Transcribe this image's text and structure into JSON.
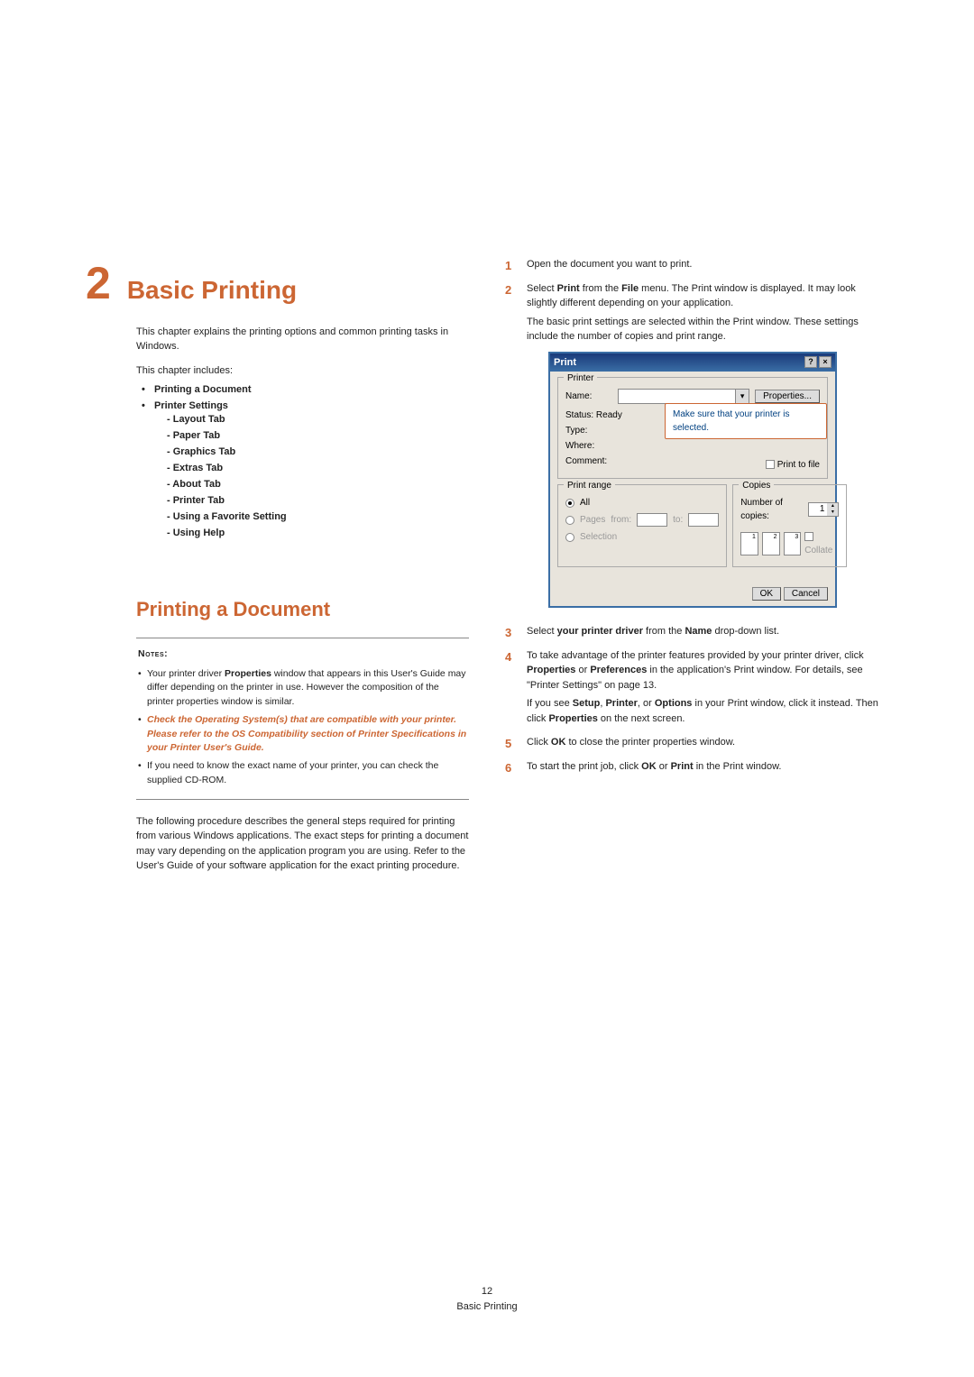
{
  "chapter": {
    "number": "2",
    "title": "Basic Printing",
    "intro": "This chapter explains the printing options and common printing tasks in Windows.",
    "includes_label": "This chapter includes:",
    "toc": [
      "Printing a Document",
      "Printer Settings"
    ],
    "toc_sub": [
      "- Layout Tab",
      "- Paper Tab",
      "- Graphics Tab",
      "- Extras Tab",
      "- About Tab",
      "- Printer Tab",
      "- Using a Favorite Setting",
      "- Using Help"
    ]
  },
  "section": {
    "heading": "Printing a Document",
    "notes_label": "Notes",
    "notes": [
      {
        "text": "Your printer driver ",
        "bold1": "Properties",
        "text2": " window that appears in this User's Guide may differ depending on the printer in use. However the composition of the printer properties window is similar."
      },
      {
        "orange": "Check the Operating System(s) that are compatible with your printer. Please refer to the OS Compatibility section of Printer Specifications in your Printer User's Guide."
      },
      {
        "text": "If you need to know the exact name of your printer, you can check the supplied CD-ROM."
      }
    ],
    "after_notes": "The following procedure describes the general steps required for printing from various Windows applications. The exact steps for printing a document may vary depending on the application program you are using. Refer to the User's Guide of your software application for the exact printing procedure."
  },
  "steps": [
    {
      "n": "1",
      "body": [
        {
          "t": "Open the document you want to print."
        }
      ]
    },
    {
      "n": "2",
      "body": [
        {
          "pre": "Select ",
          "b1": "Print",
          "mid": " from the ",
          "b2": "File",
          "post": " menu. The Print window is displayed. It may look slightly different depending on your application."
        },
        {
          "t": "The basic print settings are selected within the Print window. These settings include the number of copies and print range."
        }
      ]
    },
    {
      "n": "3",
      "body": [
        {
          "pre": "Select ",
          "b1": "your printer driver",
          "mid": " from the ",
          "b2": "Name",
          "post": " drop-down list."
        }
      ]
    },
    {
      "n": "4",
      "body": [
        {
          "pre": "To take advantage of the printer features provided by your printer driver, click ",
          "b1": "Properties",
          "mid": " or ",
          "b2": "Preferences",
          "post": " in the application's Print window. For details, see \"Printer Settings\" on page 13."
        },
        {
          "pre": "If you see ",
          "b1": "Setup",
          "mid": ", ",
          "b2": "Printer",
          "mid2": ", or ",
          "b3": "Options",
          "post": " in your Print window, click it instead. Then click ",
          "b4": "Properties",
          "post2": " on the next screen."
        }
      ]
    },
    {
      "n": "5",
      "body": [
        {
          "pre": "Click ",
          "b1": "OK",
          "post": " to close the printer properties window."
        }
      ]
    },
    {
      "n": "6",
      "body": [
        {
          "pre": "To start the print job, click ",
          "b1": "OK",
          "mid": " or ",
          "b2": "Print",
          "post": " in the Print window."
        }
      ]
    }
  ],
  "dialog": {
    "title": "Print",
    "printer_legend": "Printer",
    "name_label": "Name:",
    "properties_btn": "Properties...",
    "status_label": "Status:",
    "status_value": "Ready",
    "type_label": "Type:",
    "where_label": "Where:",
    "comment_label": "Comment:",
    "print_to_file": "Print to file",
    "callout": "Make sure that your printer is selected.",
    "range_legend": "Print range",
    "range_all": "All",
    "range_pages": "Pages",
    "range_from": "from:",
    "range_to": "to:",
    "range_selection": "Selection",
    "copies_legend": "Copies",
    "copies_label": "Number of copies:",
    "copies_value": "1",
    "collate": "Collate",
    "ok": "OK",
    "cancel": "Cancel"
  },
  "footer": {
    "page": "12",
    "title": "Basic Printing"
  }
}
